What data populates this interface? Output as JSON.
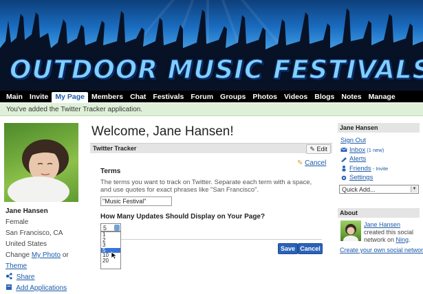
{
  "banner": {
    "title": "OUTDOOR MUSIC FESTIVALS"
  },
  "nav": {
    "items": [
      "Main",
      "Invite",
      "My Page",
      "Members",
      "Chat",
      "Festivals",
      "Forum",
      "Groups",
      "Photos",
      "Videos",
      "Blogs",
      "Notes",
      "Manage"
    ],
    "active_index": 2
  },
  "notice": {
    "text": "You've added the Twitter Tracker application."
  },
  "profile": {
    "name": "Jane Hansen",
    "gender": "Female",
    "city": "San Francisco, CA",
    "country": "United States",
    "change_prefix": "Change",
    "my_photo_link": "My Photo",
    "or_text": "or",
    "theme_link": "Theme",
    "share_link": "Share",
    "add_applications_link": "Add Applications"
  },
  "main": {
    "welcome": "Welcome, Jane Hansen!",
    "app_title": "Twitter Tracker",
    "edit_label": "Edit",
    "cancel_link": "Cancel",
    "terms_label": "Terms",
    "terms_help": "The terms you want to track on Twitter. Separate each term with a space, and use quotes for exact phrases like \"San Francisco\".",
    "terms_value": "\"Music Festival\"",
    "updates_label": "How Many Updates Should Display on Your Page?",
    "updates_selected": "5",
    "updates_options": [
      "1",
      "2",
      "3",
      "5",
      "10",
      "20"
    ],
    "save_label": "Save",
    "cancel_label": "Cancel"
  },
  "sidebar": {
    "user_name": "Jane Hansen",
    "sign_out": "Sign Out",
    "inbox_label": "Inbox",
    "inbox_count": "(1 new)",
    "alerts_label": "Alerts",
    "friends_label": "Friends",
    "friends_sub": "- Invite",
    "settings_label": "Settings",
    "quick_add": "Quick Add...",
    "about_title": "About",
    "about_name": "Jane Hansen",
    "about_text": "created this social network on",
    "about_network": "Ning",
    "create_link": "Create your own social network!"
  },
  "colors": {
    "accent": "#1a5aa8",
    "nav_bg": "#000000",
    "notice_bg": "#dff0d8",
    "button_blue": "#2a62b8"
  }
}
